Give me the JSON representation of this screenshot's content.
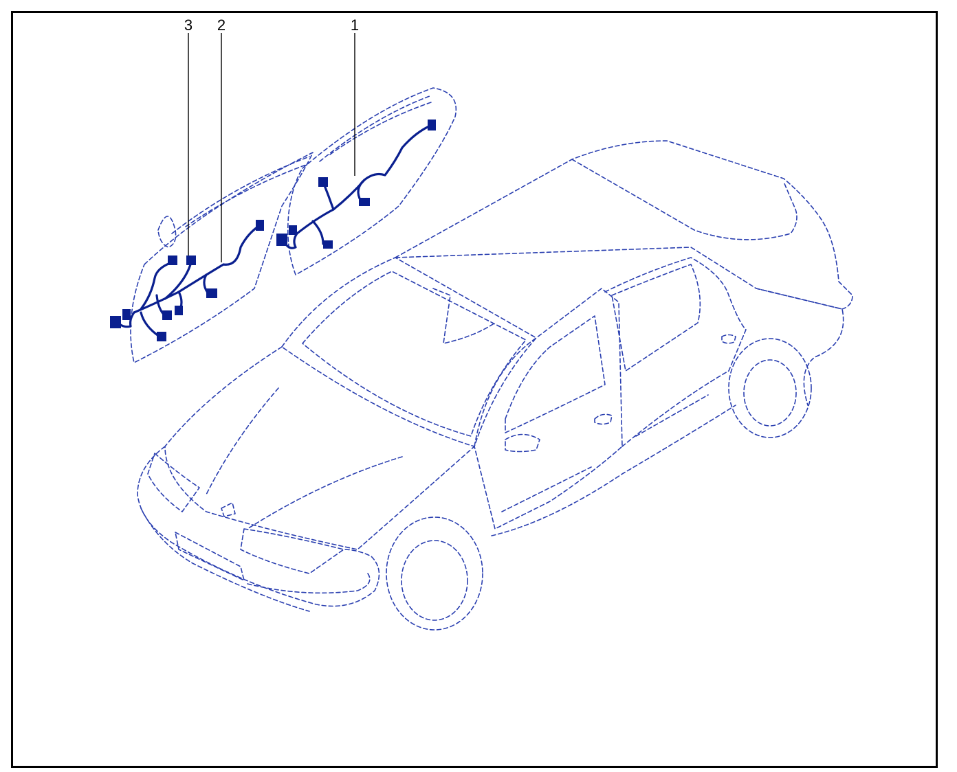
{
  "callouts": [
    {
      "id": "1",
      "label": "1"
    },
    {
      "id": "2",
      "label": "2"
    },
    {
      "id": "3",
      "label": "3"
    }
  ],
  "colors": {
    "outline": "#2a3fb0",
    "harness": "#0a1f8f",
    "frame": "#000000"
  }
}
